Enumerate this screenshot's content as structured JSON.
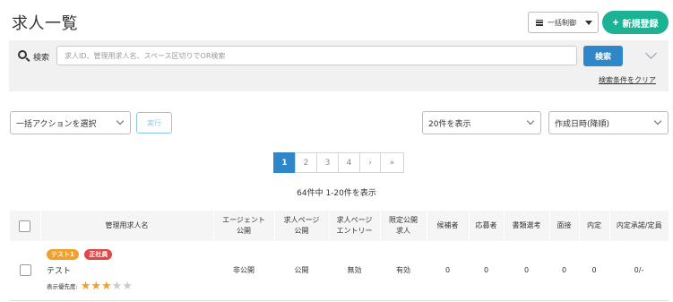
{
  "header": {
    "title": "求人一覧",
    "bulk_control_label": "一括制御",
    "new_button_label": "新規登録"
  },
  "search": {
    "label": "検索",
    "placeholder": "求人ID、管理用求人名、スペース区切りでOR検索",
    "button_label": "検索",
    "clear_link": "検索条件をクリア"
  },
  "actions": {
    "bulk_select": "一括アクションを選択",
    "exec_button": "実行",
    "per_page": "20件を表示",
    "sort": "作成日時(降順)"
  },
  "pagination": {
    "pages": [
      "1",
      "2",
      "3",
      "4"
    ],
    "active_page": "1",
    "next": "›",
    "last": "»"
  },
  "result_count": "64件中 1-20件を表示",
  "table": {
    "headers": {
      "name": "管理用求人名",
      "agent_public": "エージェント\n公開",
      "page_public": "求人ページ\n公開",
      "page_entry": "求人ページ\nエントリー",
      "limited_public": "限定公開\n求人",
      "candidates": "候補者",
      "applicants": "応募者",
      "doc_screening": "書類選考",
      "interview": "面接",
      "offer": "内定",
      "offer_accept": "内定承諾/定員"
    },
    "rows": [
      {
        "badge_test": "テスト1",
        "badge_full": "正社員",
        "title": "テスト",
        "priority_label": "表示優先度:",
        "priority_stars": 3,
        "priority_max": 5,
        "agent_public": "非公開",
        "page_public": "公開",
        "page_entry": "無効",
        "limited_public": "有効",
        "candidates": "0",
        "applicants": "0",
        "doc_screening": "0",
        "interview": "0",
        "offer": "0",
        "offer_accept": "0/-"
      }
    ]
  },
  "colors": {
    "accent_green": "#1bb394",
    "primary_blue": "#2f87c9",
    "badge_orange": "#f0a030",
    "badge_red": "#e04848"
  }
}
